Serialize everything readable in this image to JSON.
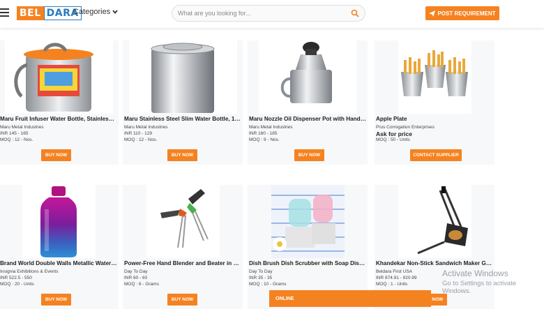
{
  "header": {
    "logo_left": "BEL",
    "logo_right": "DARA",
    "categories_label": "Categories",
    "search_placeholder": "What are you looking for...",
    "post_requirement_label": "POST REQUIREMENT"
  },
  "products": [
    {
      "title": "Maru Fruit Infuser Water Bottle, Stainless St...",
      "supplier": "Maru Metal Industries",
      "price": "INR 145 - 165",
      "moq": "MOQ : 12 - Nos.",
      "button": "BUY NOW"
    },
    {
      "title": "Maru Stainless Steel Slim Water Bottle, 1000...",
      "supplier": "Maru Metal Industries",
      "price": "INR 110 - 129",
      "moq": "MOQ : 12 - Nos.",
      "button": "BUY NOW"
    },
    {
      "title": "Maru Nozzle Oil Dispenser Pot with Handle S...",
      "supplier": "Maru Metal Industries",
      "price": "INR 160 - 185",
      "moq": "MOQ : 9 - Nos.",
      "button": "BUY NOW"
    },
    {
      "title": "Apple Plate",
      "supplier": "Prus Corrogation Enterprises",
      "price": "Ask for price",
      "moq": "MOQ : 50 - Units",
      "button": "CONTACT SUPPLIER"
    },
    {
      "title": "Brand World Double Walls Metallic Water Bo...",
      "supplier": "Insignia Exhibitions & Events",
      "price": "INR 522.5 - 550",
      "moq": "MOQ : 20 - Units",
      "button": "BUY NOW"
    },
    {
      "title": "Power-Free Hand Blender and Beater in Kitc...",
      "supplier": "Day To Day",
      "price": "INR 60 - 60",
      "moq": "MOQ : 6 - Grams",
      "button": "BUY NOW"
    },
    {
      "title": "Dish Brush Dish Scrubber with Soap Dispense...",
      "supplier": "Day To Day",
      "price": "INR 35 - 35",
      "moq": "MOQ : 10 - Grams",
      "button": "BUY NOW"
    },
    {
      "title": "Khandekar Non-Stick Sandwich Maker Grill T...",
      "supplier": "Beldara First USA",
      "price": "INR 874.91 - 920.99",
      "moq": "MOQ : 1 - Units",
      "button": "BUY NOW"
    }
  ],
  "online_bar": "ONLINE",
  "watermark": {
    "line1": "Activate Windows",
    "line2": "Go to Settings to activate Windows."
  },
  "colors": {
    "accent": "#f58220",
    "brand_blue": "#2a7bc0"
  }
}
